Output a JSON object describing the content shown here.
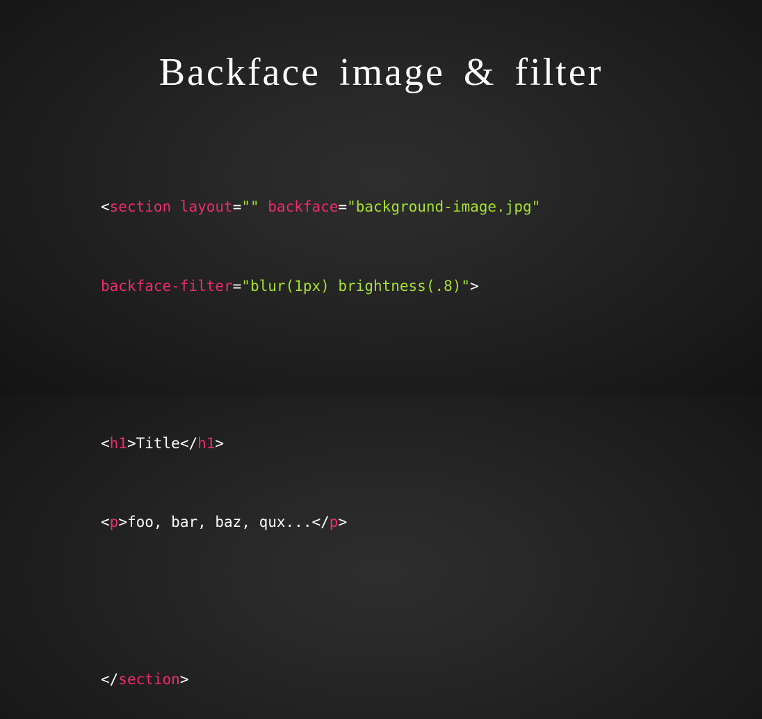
{
  "slide": {
    "title": "Backface image & filter"
  },
  "code": {
    "line1": {
      "open": "<",
      "tag": "section",
      "sp1": " ",
      "attr1": "layout",
      "eq1": "=",
      "val1": "\"\"",
      "sp2": " ",
      "attr2": "backface",
      "eq2": "=",
      "val2": "\"background-image.jpg\""
    },
    "line2": {
      "attr3": "backface-filter",
      "eq3": "=",
      "val3": "\"blur(1px) brightness(.8)\"",
      "close": ">"
    },
    "line4": {
      "open1": "<",
      "tag1": "h1",
      "close1": ">",
      "content": "Title",
      "open2": "</",
      "tag2": "h1",
      "close2": ">"
    },
    "line5": {
      "open1": "<",
      "tag1": "p",
      "close1": ">",
      "content": "foo, bar, baz, qux...",
      "open2": "</",
      "tag2": "p",
      "close2": ">"
    },
    "line7": {
      "open": "</",
      "tag": "section",
      "close": ">"
    }
  },
  "colors": {
    "tag": "#ee2c6c",
    "string": "#a6e22e",
    "text": "#ffffff",
    "background": "#1e1e1e"
  }
}
